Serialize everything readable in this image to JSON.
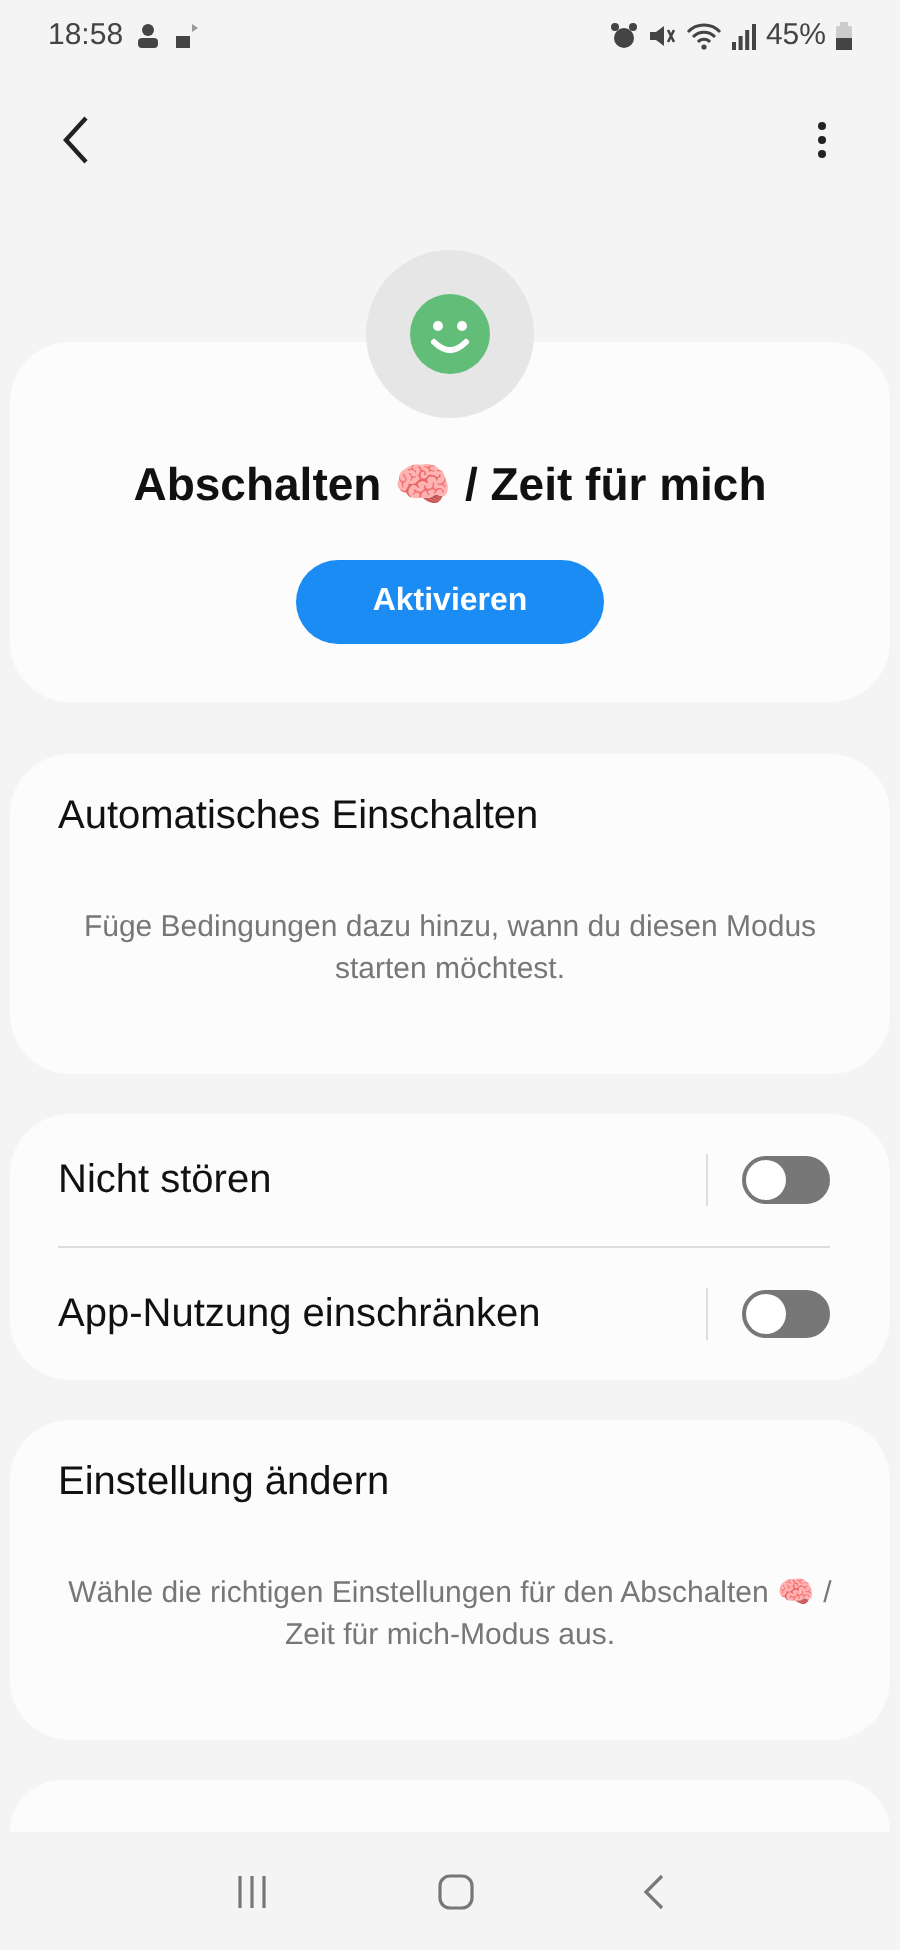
{
  "status_bar": {
    "time": "18:58",
    "battery": "45%"
  },
  "mode": {
    "title": "Abschalten 🧠 / Zeit für mich",
    "button": "Aktivieren"
  },
  "auto": {
    "title": "Automatisches Einschalten",
    "hint": "Füge Bedingungen dazu hinzu, wann du diesen Modus starten möchtest."
  },
  "toggles": [
    {
      "label": "Nicht stören",
      "on": false
    },
    {
      "label": "App-Nutzung einschränken",
      "on": false
    }
  ],
  "settings": {
    "title": "Einstellung ändern",
    "hint": "Wähle die richtigen Einstellungen für den Abschalten 🧠 / Zeit für mich-Modus aus."
  }
}
